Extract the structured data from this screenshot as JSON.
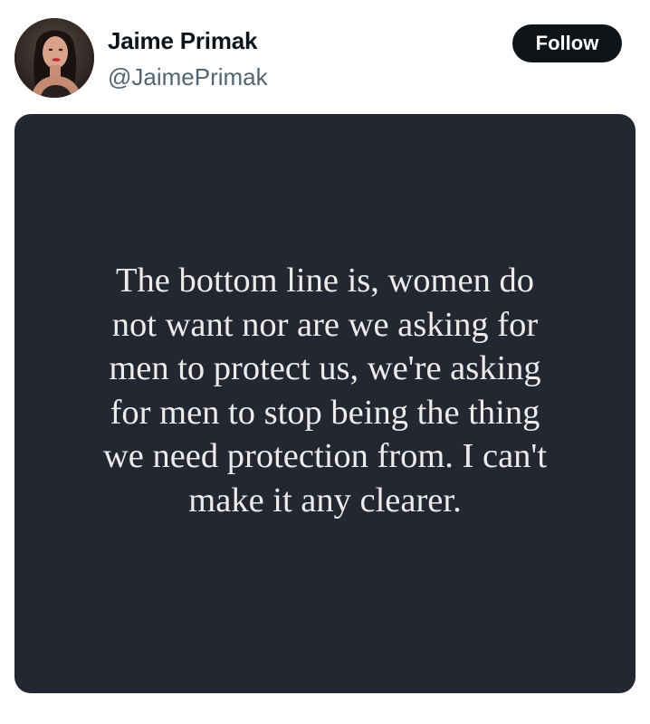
{
  "author": {
    "display_name": "Jaime Primak",
    "handle": "@JaimePrimak",
    "avatar_icon": "profile-photo"
  },
  "follow_button": {
    "label": "Follow"
  },
  "media": {
    "background_color": "#242631",
    "text_color": "#ececec",
    "quote_lines": [
      "The bottom line is, women do",
      "not want nor are we asking for",
      "men to protect us, we're asking",
      "for men to stop being the thing",
      "we need protection from. I can't",
      "make it any clearer."
    ]
  }
}
